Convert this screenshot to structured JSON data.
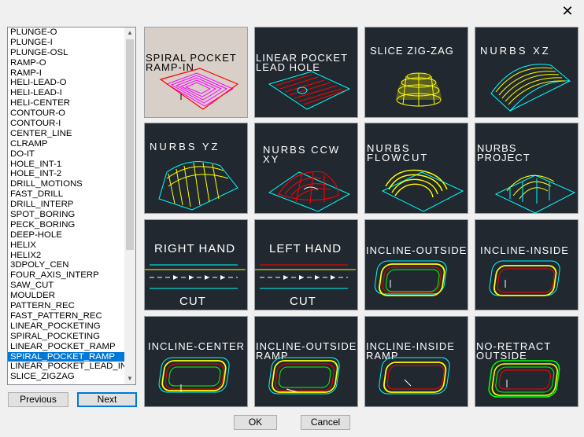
{
  "window": {
    "close_glyph": "✕"
  },
  "list": {
    "items": [
      "PLUNGE-O",
      "PLUNGE-I",
      "PLUNGE-OSL",
      "RAMP-O",
      "RAMP-I",
      "HELI-LEAD-O",
      "HELI-LEAD-I",
      "HELI-CENTER",
      "CONTOUR-O",
      "CONTOUR-I",
      "CENTER_LINE",
      "CLRAMP",
      "DO-IT",
      "HOLE_INT-1",
      "HOLE_INT-2",
      "DRILL_MOTIONS",
      "FAST_DRILL",
      "DRILL_INTERP",
      "SPOT_BORING",
      "PECK_BORING",
      "DEEP-HOLE",
      "HELIX",
      "HELIX2",
      "3DPOLY_CEN",
      "FOUR_AXIS_INTERP",
      "SAW_CUT",
      "MOULDER",
      "PATTERN_REC",
      "FAST_PATTERN_REC",
      "LINEAR_POCKETING",
      "SPIRAL_POCKETING",
      "LINEAR_POCKET_RAMP",
      "SPIRAL_POCKET_RAMP",
      "LINEAR_POCKET_LEAD_IN",
      "SLICE_ZIGZAG"
    ],
    "selected": "SPIRAL_POCKET_RAMP"
  },
  "buttons": {
    "previous": "Previous",
    "next": "Next",
    "ok": "OK",
    "cancel": "Cancel"
  },
  "tiles": [
    {
      "label": "SPIRAL POCKET\nRAMP-IN"
    },
    {
      "label": "LINEAR POCKET\nLEAD HOLE"
    },
    {
      "label": "SLICE ZIG-ZAG"
    },
    {
      "label": "NURBS XZ"
    },
    {
      "label": "NURBS YZ"
    },
    {
      "label": "NURBS CCW\nXY"
    },
    {
      "label": "NURBS\nFLOWCUT"
    },
    {
      "label": "NURBS\nPROJECT"
    },
    {
      "label": "RIGHT HAND",
      "sub": "CUT"
    },
    {
      "label": "LEFT HAND",
      "sub": "CUT"
    },
    {
      "label": "INCLINE-OUTSIDE"
    },
    {
      "label": "INCLINE-INSIDE"
    },
    {
      "label": "INCLINE-CENTER"
    },
    {
      "label": "INCLINE-OUTSIDE\nRAMP"
    },
    {
      "label": "INCLINE-INSIDE\nRAMP"
    },
    {
      "label": "NO-RETRACT\nOUTSIDE"
    }
  ],
  "colors": {
    "accent": "#0078d7",
    "tile_bg": "#212830",
    "cyan": "#00ffff",
    "yellow": "#ffff00",
    "red": "#ff0000",
    "magenta": "#ff00ff",
    "green": "#00ff00"
  }
}
